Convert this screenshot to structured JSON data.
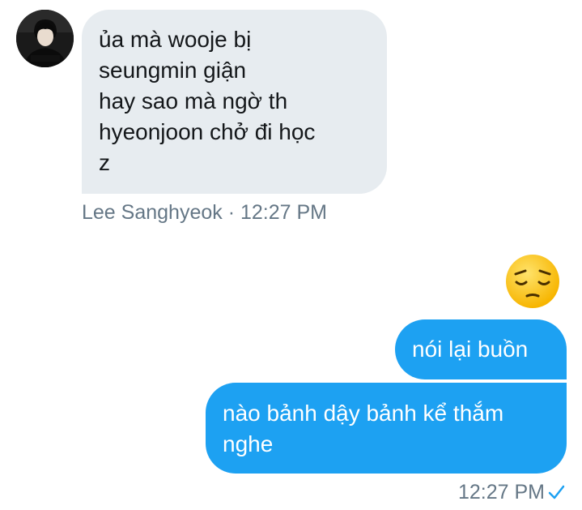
{
  "conversation": {
    "incoming": {
      "avatar_icon": "user-avatar-icon",
      "message_lines": [
        "ủa mà wooje bị",
        "seungmin giận",
        "hay sao mà ngờ th",
        "hyeonjoon chở đi học",
        "z"
      ],
      "sender": "Lee Sanghyeok",
      "separator": "·",
      "time": "12:27 PM"
    },
    "outgoing": {
      "emoji_icon": "pensive-face-emoji",
      "message_1": "nói lại buồn",
      "message_2_lines": [
        "nào bảnh dậy bảnh kể thắm",
        "nghe"
      ],
      "time": "12:27 PM",
      "status_icon": "checkmark-icon"
    },
    "colors": {
      "outgoing_bubble": "#1da1f2",
      "incoming_bubble": "#e7ecf0",
      "meta_text": "#657786"
    }
  }
}
